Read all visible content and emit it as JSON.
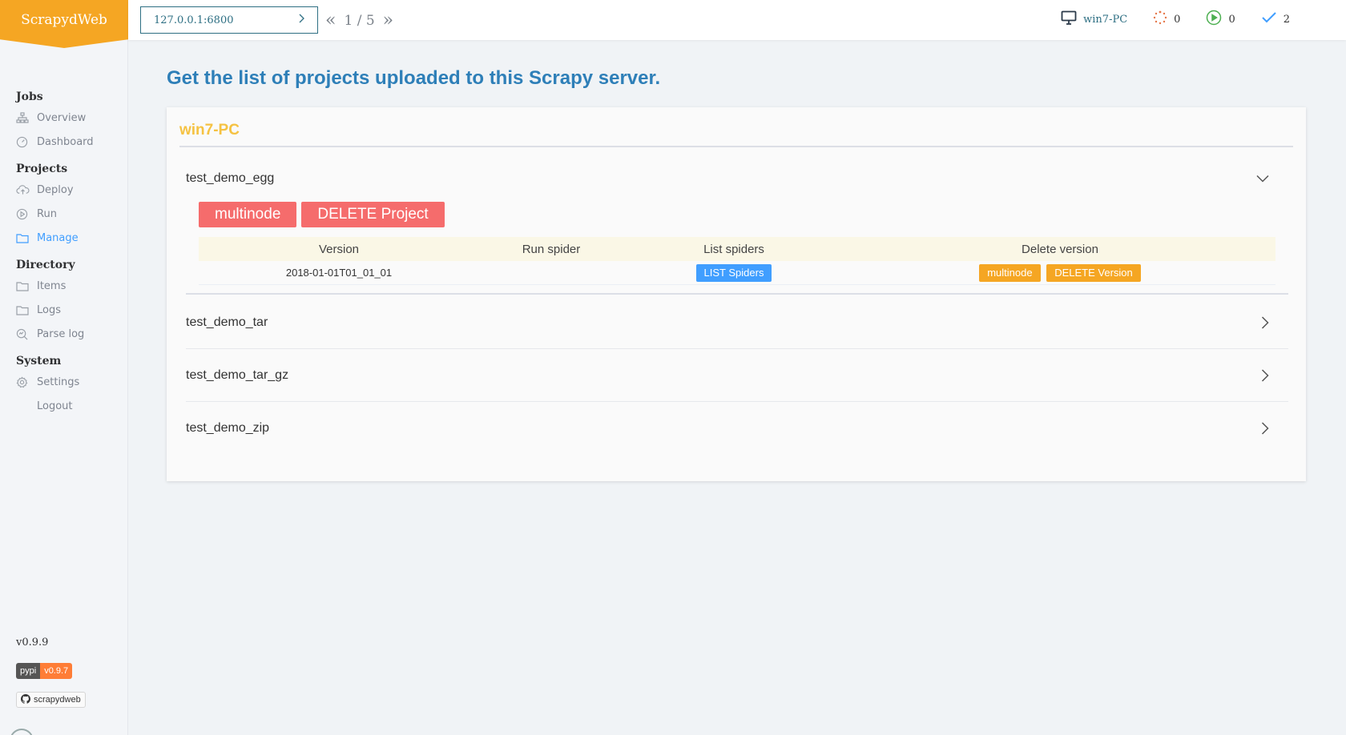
{
  "app": {
    "logo": "ScrapydWeb"
  },
  "sidebar": {
    "sections": [
      {
        "title": "Jobs",
        "items": [
          {
            "label": "Overview",
            "icon": "sitemap-icon"
          },
          {
            "label": "Dashboard",
            "icon": "gauge-icon"
          }
        ]
      },
      {
        "title": "Projects",
        "items": [
          {
            "label": "Deploy",
            "icon": "upload-cloud-icon"
          },
          {
            "label": "Run",
            "icon": "play-circle-icon"
          },
          {
            "label": "Manage",
            "icon": "folder-icon",
            "active": true
          }
        ]
      },
      {
        "title": "Directory",
        "items": [
          {
            "label": "Items",
            "icon": "folder-icon"
          },
          {
            "label": "Logs",
            "icon": "folder-icon"
          },
          {
            "label": "Parse log",
            "icon": "search-chart-icon"
          }
        ]
      },
      {
        "title": "System",
        "items": [
          {
            "label": "Settings",
            "icon": "gear-icon"
          },
          {
            "label": "Logout",
            "icon": ""
          }
        ]
      }
    ],
    "version": "v0.9.9",
    "pypi_label": "pypi",
    "pypi_version": "v0.9.7",
    "github_label": "scrapydweb"
  },
  "header": {
    "node_address": "127.0.0.1:6800",
    "pager": "1 / 5",
    "host": "win7-PC",
    "pending_count": "0",
    "running_count": "0",
    "finished_count": "2"
  },
  "main": {
    "title": "Get the list of projects uploaded to this Scrapy server.",
    "node_name": "win7-PC",
    "projects": [
      {
        "name": "test_demo_egg",
        "expanded": true
      },
      {
        "name": "test_demo_tar",
        "expanded": false
      },
      {
        "name": "test_demo_tar_gz",
        "expanded": false
      },
      {
        "name": "test_demo_zip",
        "expanded": false
      }
    ],
    "buttons": {
      "multinode": "multinode",
      "delete_project": "DELETE Project"
    },
    "table": {
      "headers": [
        "Version",
        "Run spider",
        "List spiders",
        "Delete version"
      ],
      "rows": [
        {
          "version": "2018-01-01T01_01_01",
          "run_spider": "",
          "list_spiders": "LIST Spiders",
          "multinode": "multinode",
          "delete_version": "DELETE Version"
        }
      ]
    }
  },
  "colors": {
    "accent": "#f5a623",
    "primary": "#409eff",
    "danger": "#f56c6c",
    "title": "#2e7fb8",
    "node": "#f5c242"
  }
}
